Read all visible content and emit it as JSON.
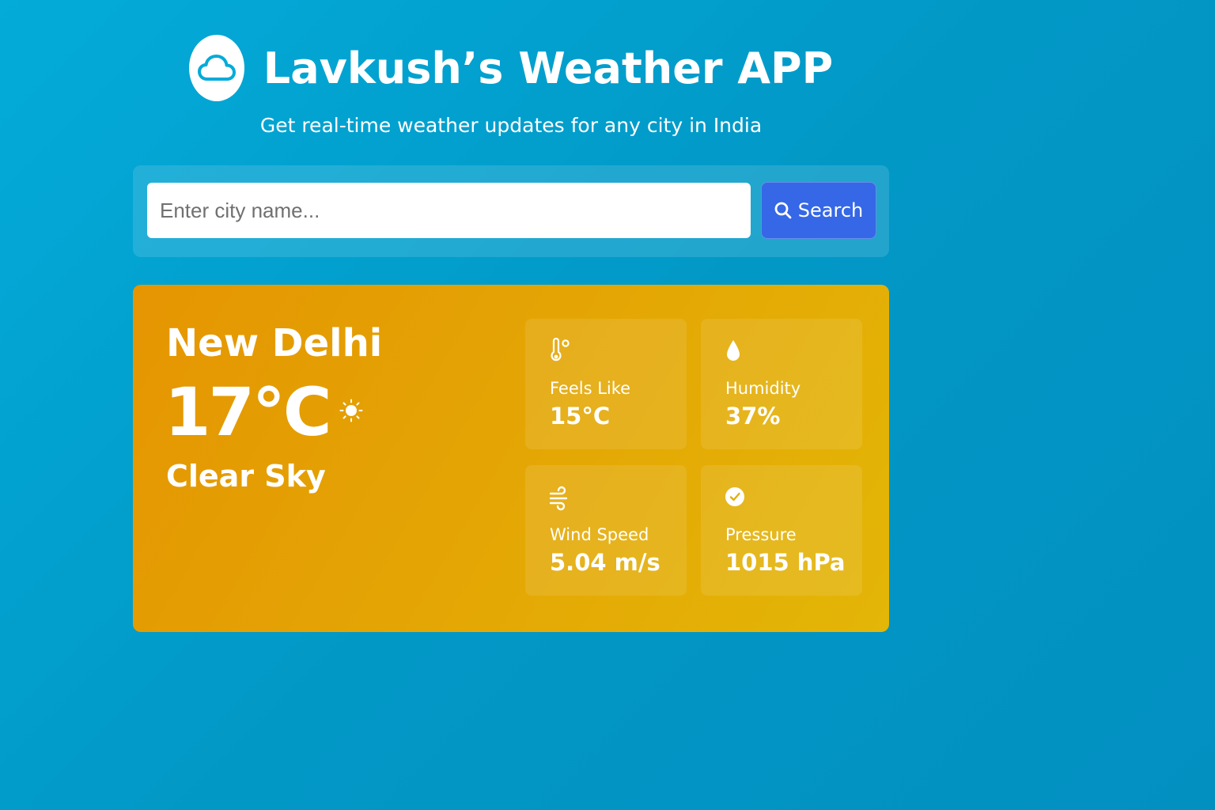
{
  "header": {
    "title": "Lavkush’s Weather APP",
    "logo_icon": "cloud-icon",
    "subtitle": "Get real-time weather updates for any city in India"
  },
  "search": {
    "value": "",
    "placeholder": "Enter city name...",
    "button_label": "Search",
    "button_icon": "search-icon"
  },
  "weather": {
    "city": "New Delhi",
    "temperature": "17°C",
    "condition_icon": "sun-icon",
    "condition": "Clear Sky",
    "stats": [
      {
        "icon": "thermometer-icon",
        "label": "Feels Like",
        "value": "15°C"
      },
      {
        "icon": "droplet-icon",
        "label": "Humidity",
        "value": "37%"
      },
      {
        "icon": "wind-icon",
        "label": "Wind Speed",
        "value": "5.04 m/s"
      },
      {
        "icon": "gauge-check-icon",
        "label": "Pressure",
        "value": "1015 hPa"
      }
    ]
  },
  "colors": {
    "background": "#03abd9",
    "card": "#e59502",
    "button": "#3567e6"
  }
}
